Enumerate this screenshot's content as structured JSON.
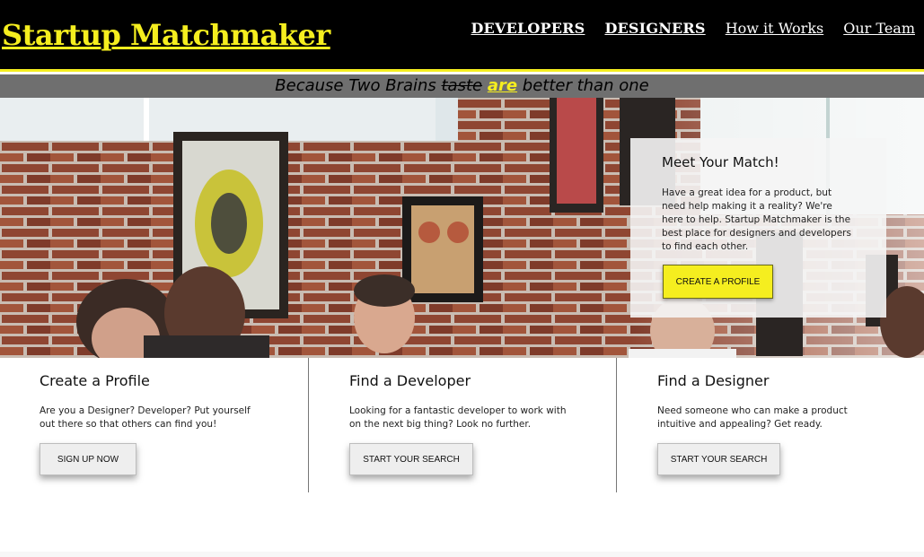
{
  "header": {
    "brand": "Startup Matchmaker",
    "nav": [
      {
        "label": "DEVELOPERS"
      },
      {
        "label": "DESIGNERS"
      },
      {
        "label": "How it Works"
      },
      {
        "label": "Our Team"
      }
    ]
  },
  "tagline": {
    "before": "Because Two Brains ",
    "struck": "taste",
    "highlight": "are",
    "after": " better than one"
  },
  "hero": {
    "card_title": "Meet Your Match!",
    "card_text": "Have a great idea for a product, but need help making it a reality? We're here to help. Startup Matchmaker is the best place for designers and developers to find each other.",
    "cta_label": "CREATE A PROFILE"
  },
  "features": [
    {
      "title": "Create a Profile",
      "text": "Are you a Designer? Developer? Put yourself out there so that others can find you!",
      "button": "SIGN UP NOW"
    },
    {
      "title": "Find a Developer",
      "text": "Looking for a fantastic developer to work with on the next big thing? Look no further.",
      "button": "START YOUR SEARCH"
    },
    {
      "title": "Find a Designer",
      "text": "Need someone who can make a product intuitive and appealing? Get ready.",
      "button": "START YOUR SEARCH"
    }
  ],
  "colors": {
    "accent_yellow": "#f5ee1f",
    "header_bg": "#000000",
    "tagline_bg": "#6f6f6f"
  }
}
